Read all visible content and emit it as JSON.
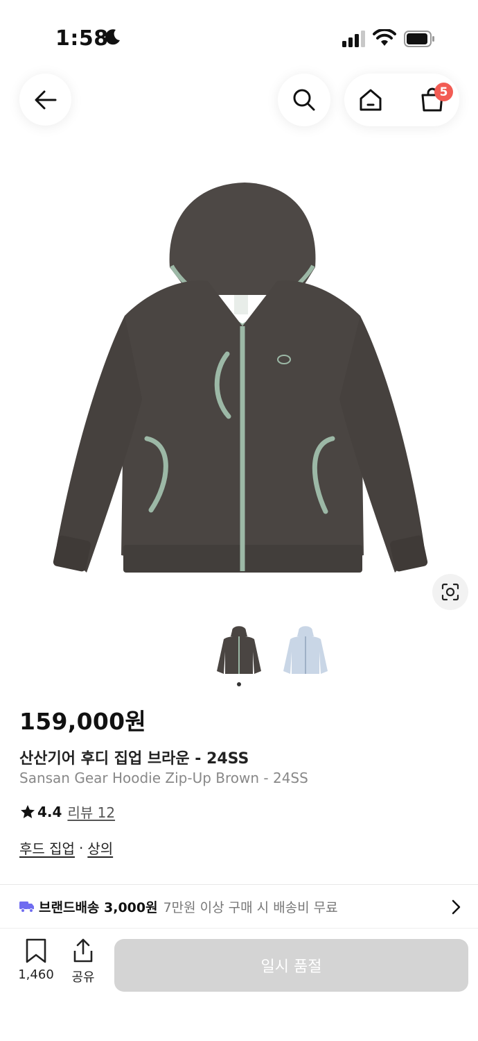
{
  "status_bar": {
    "time": "1:58"
  },
  "header": {
    "cart_count": "5"
  },
  "product": {
    "price": "159,000원",
    "name_ko": "산산기어 후디 집업 브라운 - 24SS",
    "name_en": "Sansan Gear Hoodie Zip-Up Brown - 24SS",
    "rating": "4.4",
    "review_label": "리뷰 12",
    "category_main": "후드 집업",
    "category_separator": "·",
    "category_sub": "상의",
    "colors": {
      "hoodie_brown": "#4a4542",
      "trim_mint": "#9cb8a6",
      "hoodie_blue": "#c9d6e6"
    }
  },
  "shipping": {
    "label": "브랜드배송 3,000원",
    "note": "7만원 이상 구매 시 배송비 무료"
  },
  "bottom": {
    "wish_count": "1,460",
    "share_label": "공유",
    "buy_button": "일시 품절"
  },
  "accent": {
    "badge": "#f25c54",
    "truck": "#6f6cf0",
    "disabled_button": "#d4d4d4"
  }
}
